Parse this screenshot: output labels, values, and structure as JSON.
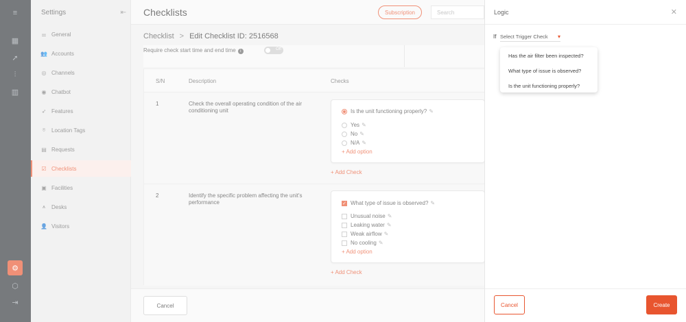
{
  "rail": {
    "icons": [
      "menu-expand-icon",
      "dashboard-icon",
      "rocket-icon",
      "analytics-icon",
      "chart-icon",
      "settings-icon",
      "cube-icon",
      "logout-icon"
    ]
  },
  "sidebar": {
    "title": "Settings",
    "items": [
      {
        "label": "General",
        "icon": "sliders-icon"
      },
      {
        "label": "Accounts",
        "icon": "users-icon"
      },
      {
        "label": "Channels",
        "icon": "channels-icon"
      },
      {
        "label": "Chatbot",
        "icon": "chat-icon"
      },
      {
        "label": "Features",
        "icon": "rocket-icon"
      },
      {
        "label": "Location Tags",
        "icon": "location-icon"
      },
      {
        "label": "Requests",
        "icon": "requests-icon"
      },
      {
        "label": "Checklists",
        "icon": "checklist-icon"
      },
      {
        "label": "Facilities",
        "icon": "facilities-icon"
      },
      {
        "label": "Desks",
        "icon": "desk-icon"
      },
      {
        "label": "Visitors",
        "icon": "visitors-icon"
      }
    ],
    "active_index": 7
  },
  "header": {
    "title": "Checklists",
    "subscription_label": "Subscription",
    "search_placeholder": "Search"
  },
  "breadcrumb": {
    "root": "Checklist",
    "separator": ">",
    "current": "Edit Checklist ID: 2516568"
  },
  "settings_panel": {
    "require_label": "Require check start time and end time",
    "toggle_label": "Off"
  },
  "table": {
    "headers": {
      "sn": "S/N",
      "description": "Description",
      "checks": "Checks"
    },
    "rows": [
      {
        "sn": "1",
        "description": "Check the overall operating condition of the air conditioning unit",
        "question": "Is the unit functioning properly?",
        "question_type": "radio",
        "options": [
          "Yes",
          "No",
          "N/A"
        ],
        "add_option": "+ Add option",
        "add_check": "+ Add Check"
      },
      {
        "sn": "2",
        "description": "Identify the specific problem affecting the unit's performance",
        "question": "What type of issue is observed?",
        "question_type": "checkbox",
        "options": [
          "Unusual noise",
          "Leaking water",
          "Weak airflow",
          "No cooling"
        ],
        "add_option": "+ Add option",
        "add_check": "+ Add Check"
      }
    ]
  },
  "footer": {
    "cancel_label": "Cancel"
  },
  "drawer": {
    "title": "Logic",
    "if_label": "If",
    "trigger_placeholder": "Select Trigger Check",
    "dropdown_options": [
      "Has the air filter been inspected?",
      "What type of issue is observed?",
      "Is the unit functioning properly?"
    ],
    "cancel_label": "Cancel",
    "create_label": "Create"
  },
  "colors": {
    "accent": "#e8552f",
    "rail_bg": "#2f3338"
  }
}
